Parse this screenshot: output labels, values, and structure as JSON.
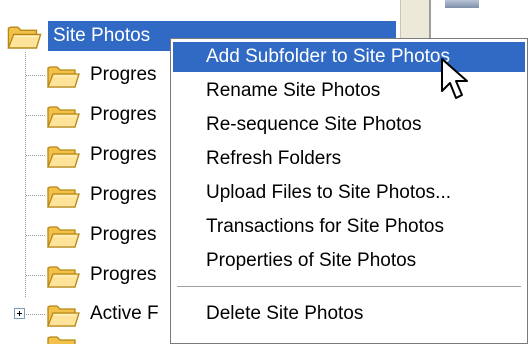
{
  "tree": {
    "root": {
      "label": "Site Photos"
    },
    "children": [
      {
        "label": "Progres"
      },
      {
        "label": "Progres"
      },
      {
        "label": "Progres"
      },
      {
        "label": "Progres"
      },
      {
        "label": "Progres"
      },
      {
        "label": "Progres"
      },
      {
        "label": "Active F"
      }
    ]
  },
  "context_menu": {
    "items": [
      {
        "label": "Add Subfolder to Site Photos",
        "highlighted": true
      },
      {
        "label": "Rename Site Photos"
      },
      {
        "label": "Re-sequence Site Photos"
      },
      {
        "label": "Refresh Folders"
      },
      {
        "label": "Upload Files to Site Photos..."
      },
      {
        "label": "Transactions for Site Photos"
      },
      {
        "label": "Properties of Site Photos"
      }
    ],
    "delete_item": {
      "label": "Delete Site Photos"
    }
  },
  "colors": {
    "selection": "#316ac5",
    "folder_fill": "#f7d36b",
    "folder_outline": "#c8951f"
  },
  "icons": {
    "folder": "folder-icon",
    "expand": "plus-box-icon",
    "cursor": "arrow-cursor-icon"
  }
}
